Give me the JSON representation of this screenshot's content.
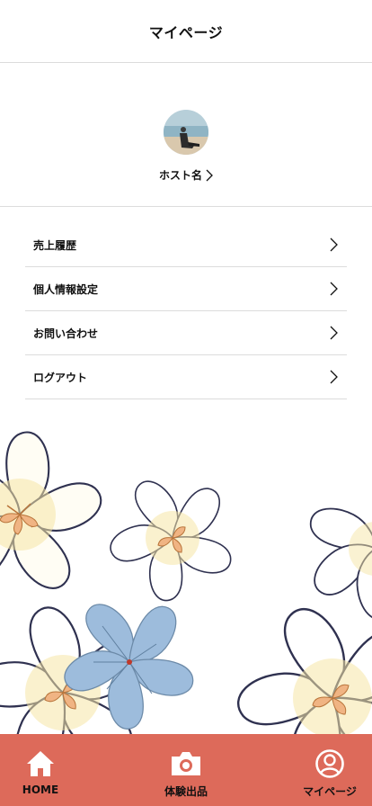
{
  "header": {
    "title": "マイページ"
  },
  "profile": {
    "host_name": "ホスト名"
  },
  "menu": {
    "items": [
      {
        "label": "売上履歴"
      },
      {
        "label": "個人情報設定"
      },
      {
        "label": "お問い合わせ"
      },
      {
        "label": "ログアウト"
      }
    ]
  },
  "tabbar": {
    "tabs": [
      {
        "label": "HOME",
        "icon": "home-icon"
      },
      {
        "label": "体験出品",
        "icon": "camera-icon"
      },
      {
        "label": "マイページ",
        "icon": "user-circle-icon"
      }
    ]
  },
  "colors": {
    "tabbar": "#dd6a5a",
    "divider": "#dcdcdc",
    "outline": "#2f3150",
    "petal_center": "#f6e9a8",
    "stamen": "#f0b483",
    "blue_flower": "#8fb2d6"
  }
}
